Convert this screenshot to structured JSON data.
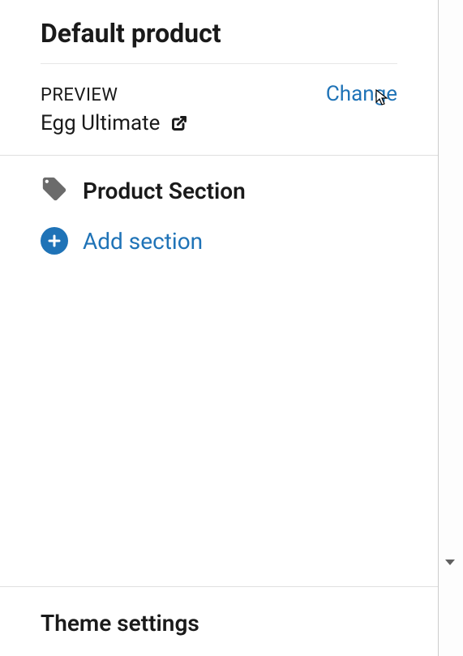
{
  "header": {
    "title": "Default product"
  },
  "preview": {
    "label": "PREVIEW",
    "change_link": "Change",
    "product_name": "Egg Ultimate"
  },
  "sections": {
    "items": [
      {
        "label": "Product Section"
      }
    ],
    "add_label": "Add section"
  },
  "footer": {
    "theme_settings": "Theme settings"
  }
}
